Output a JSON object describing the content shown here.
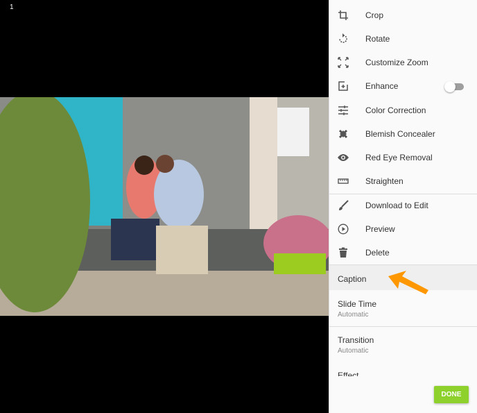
{
  "viewer": {
    "slide_number": "1"
  },
  "menu": {
    "items": [
      {
        "label": "Crop",
        "icon": "crop-icon"
      },
      {
        "label": "Rotate",
        "icon": "rotate-icon"
      },
      {
        "label": "Customize Zoom",
        "icon": "zoom-icon"
      },
      {
        "label": "Enhance",
        "icon": "enhance-icon",
        "toggle": false
      },
      {
        "label": "Color Correction",
        "icon": "sliders-icon"
      },
      {
        "label": "Blemish Concealer",
        "icon": "bandage-icon"
      },
      {
        "label": "Red Eye Removal",
        "icon": "eye-icon"
      },
      {
        "label": "Straighten",
        "icon": "ruler-icon"
      },
      {
        "label": "Download to Edit",
        "icon": "brush-icon"
      },
      {
        "label": "Preview",
        "icon": "play-icon"
      },
      {
        "label": "Delete",
        "icon": "trash-icon"
      }
    ],
    "caption": "Caption",
    "slide_time": {
      "label": "Slide Time",
      "value": "Automatic"
    },
    "transition": {
      "label": "Transition",
      "value": "Automatic"
    },
    "effect": {
      "label": "Effect"
    },
    "done": "DONE"
  },
  "colors": {
    "accent": "#8fd12c",
    "arrow": "#ff9800"
  }
}
